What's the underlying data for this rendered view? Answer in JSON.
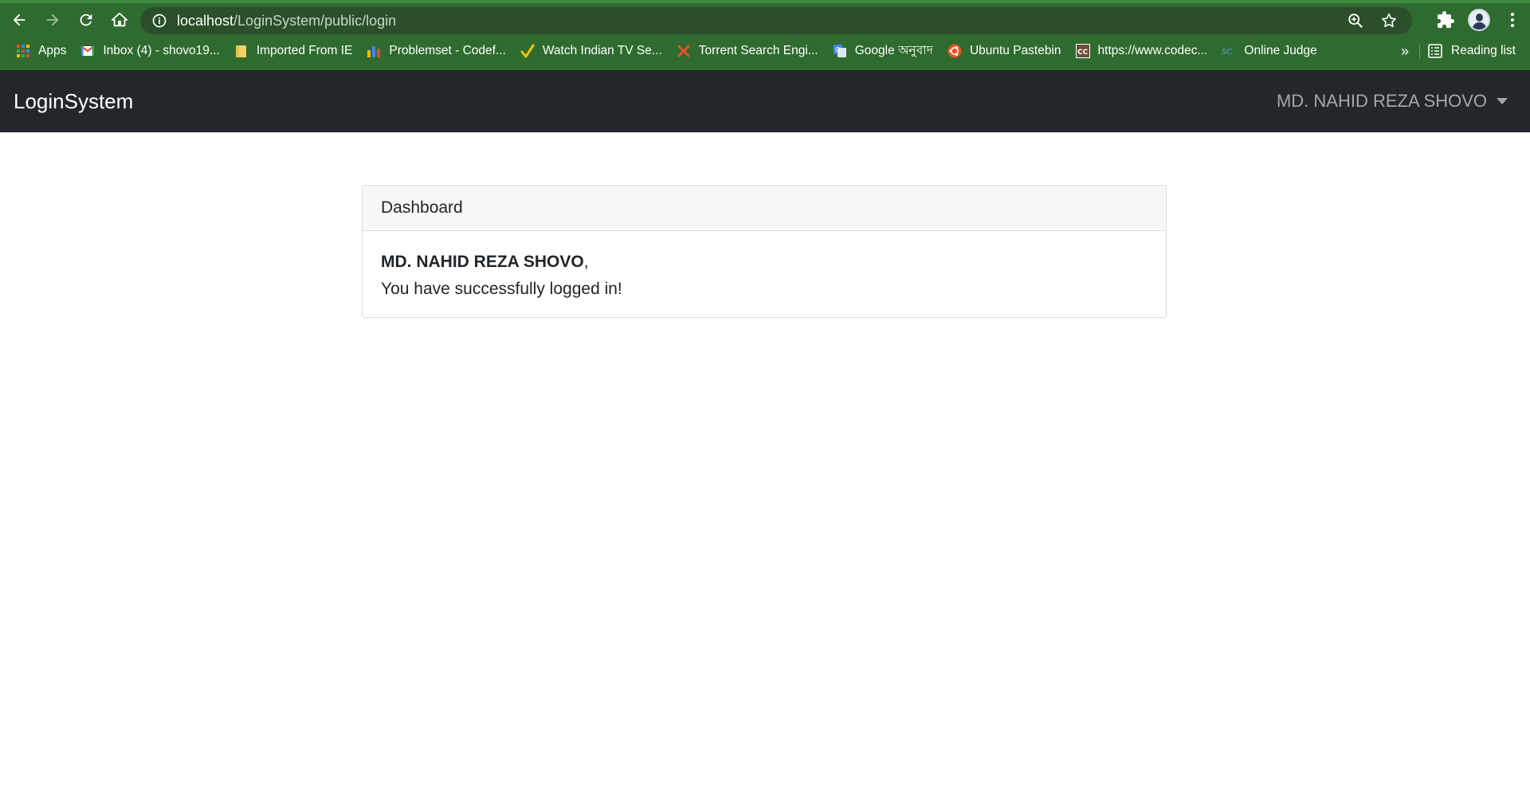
{
  "browser": {
    "url_host": "localhost",
    "url_path": "/LoginSystem/public/login",
    "bookmarks": [
      {
        "label": "Apps",
        "icon": "apps-grid-icon"
      },
      {
        "label": "Inbox (4) - shovo19...",
        "icon": "gmail-icon"
      },
      {
        "label": "Imported From IE",
        "icon": "folder-icon"
      },
      {
        "label": "Problemset - Codef...",
        "icon": "codeforces-icon"
      },
      {
        "label": "Watch Indian TV Se...",
        "icon": "checkmark-icon"
      },
      {
        "label": "Torrent Search Engi...",
        "icon": "x-icon"
      },
      {
        "label": "Google অনুবাদ",
        "icon": "google-translate-icon"
      },
      {
        "label": "Ubuntu Pastebin",
        "icon": "ubuntu-icon"
      },
      {
        "label": "https://www.codec...",
        "icon": "codechef-icon"
      },
      {
        "label": "Online Judge",
        "icon": "sc-icon"
      }
    ],
    "more_label": "»",
    "reading_list_label": "Reading list"
  },
  "navbar": {
    "brand": "LoginSystem",
    "user_name": "MD. NAHID REZA SHOVO"
  },
  "card": {
    "header": "Dashboard",
    "user_name": "MD. NAHID REZA SHOVO",
    "comma": ",",
    "message": "You have successfully logged in!"
  },
  "colors": {
    "chrome_bg": "#2f6b2f",
    "navbar_bg": "#23272b",
    "card_header_bg": "#f7f7f7"
  }
}
